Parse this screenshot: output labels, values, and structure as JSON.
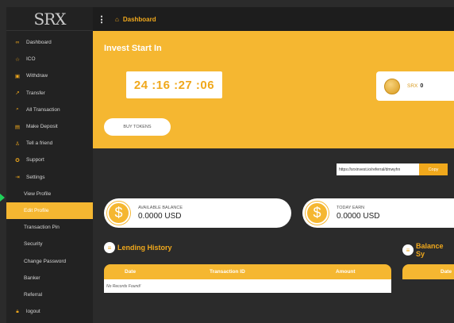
{
  "logo": {
    "text": "SRX"
  },
  "sidebar": {
    "items": [
      {
        "label": "Dashboard",
        "icon": "speedometer-icon"
      },
      {
        "label": "ICO",
        "icon": "star-icon"
      },
      {
        "label": "Withdraw",
        "icon": "wallet-icon"
      },
      {
        "label": "Transfer",
        "icon": "transfer-icon"
      },
      {
        "label": "All Transaction",
        "icon": "search-icon"
      },
      {
        "label": "Make Deposit",
        "icon": "deposit-icon"
      },
      {
        "label": "Tell a friend",
        "icon": "user-icon"
      },
      {
        "label": "Support",
        "icon": "support-icon"
      },
      {
        "label": "Settings",
        "icon": "signin-icon"
      },
      {
        "label": "View Profile"
      },
      {
        "label": "Edit Profile"
      },
      {
        "label": "Transaction Pin"
      },
      {
        "label": "Security"
      },
      {
        "label": "Change Password"
      },
      {
        "label": "Banker"
      },
      {
        "label": "Referral"
      },
      {
        "label": "logout",
        "icon": "lock-icon"
      }
    ],
    "active_item": "Edit Profile"
  },
  "topbar": {
    "title": "Dashboard"
  },
  "hero": {
    "title": "Invest Start In",
    "countdown": "24 :16 :27 :06",
    "buy_button": "BUY TOKENS",
    "token_label": "SRX",
    "token_balance": "0"
  },
  "referral": {
    "link": "https://srxinvest.io/referral/dmwyhn",
    "copy_label": "Copy"
  },
  "balances": {
    "available": {
      "label": "AVAILABLE BALANCE",
      "value": "0.0000 USD"
    },
    "today": {
      "label": "TODAY EARN",
      "value": "0.0000 USD"
    }
  },
  "lending": {
    "title": "Lending History",
    "columns": [
      "Date",
      "Transaction ID",
      "Amount"
    ],
    "empty_text": "No Records Found!"
  },
  "balance_section": {
    "title": "Balance Sy",
    "column": "Date"
  },
  "colors": {
    "accent": "#f5b731",
    "dark": "#2b2b2b",
    "sidebar": "#222222"
  }
}
